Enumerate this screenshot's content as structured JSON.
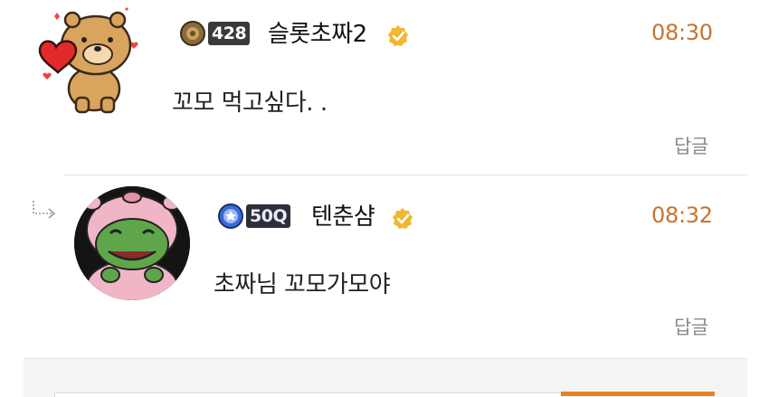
{
  "comments": [
    {
      "level_badge": "428",
      "username": "슬롯초짜2",
      "time": "08:30",
      "message": "꼬모 먹고싶다. .",
      "reply_label": "답글"
    },
    {
      "level_badge": "50Q",
      "username": "텐춘샴",
      "time": "08:32",
      "message": "초짜님 꼬모가모야",
      "reply_label": "답글"
    }
  ],
  "colors": {
    "time": "#c8732c",
    "verified": "#f2b632",
    "reply": "#8a8a8a",
    "accent_button": "#e6821f"
  },
  "icons": [
    "bear-heart-avatar",
    "frog-pig-avatar",
    "bronze-medal-icon",
    "blue-medal-icon",
    "verified-badge-icon",
    "reply-arrow-icon"
  ]
}
